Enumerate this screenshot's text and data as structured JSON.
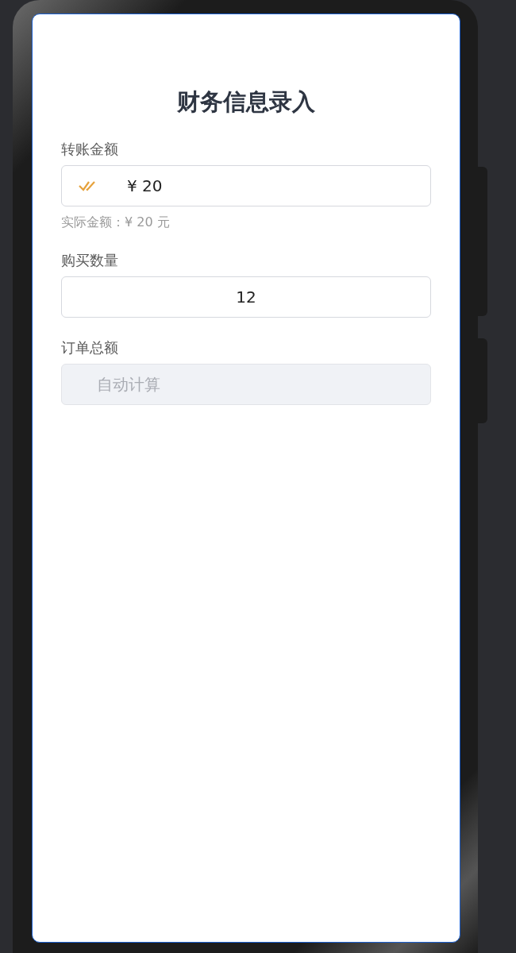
{
  "title": "财务信息录入",
  "fields": [
    {
      "kind": "icon_value",
      "label": "转账金额",
      "value": "¥ 20",
      "hint": "实际金额：¥ 20 元",
      "disabled": false
    },
    {
      "kind": "centered",
      "label": "购买数量",
      "value": "12",
      "disabled": false
    },
    {
      "kind": "plain",
      "label": "订单总额",
      "placeholder": "自动计算",
      "disabled": true
    }
  ]
}
